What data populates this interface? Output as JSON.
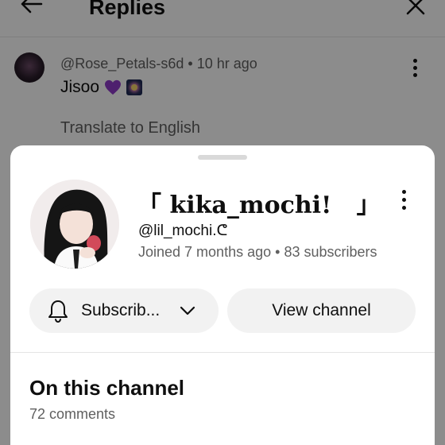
{
  "background": {
    "title": "Replies",
    "comment": {
      "author": "@Rose_Petals-s6d",
      "time": "10 hr ago",
      "text": "Jisoo",
      "emojis": [
        "purple-heart",
        "fireworks"
      ],
      "translate": "Translate to English"
    }
  },
  "channel": {
    "name": "「 kika_mochi!   」",
    "handle": "@lil_mochi.ᕦ",
    "joined": "Joined 7 months ago",
    "subscribers": "83 subscribers",
    "subscribe_label": "Subscrib...",
    "view_label": "View channel"
  },
  "section": {
    "title": "On this channel",
    "comments": "72 comments"
  },
  "colors": {
    "scrim": "#000000",
    "sheet": "#ffffff",
    "button_bg": "#f2f2f2",
    "text_primary": "#0f0f0f",
    "text_secondary": "#606060"
  }
}
